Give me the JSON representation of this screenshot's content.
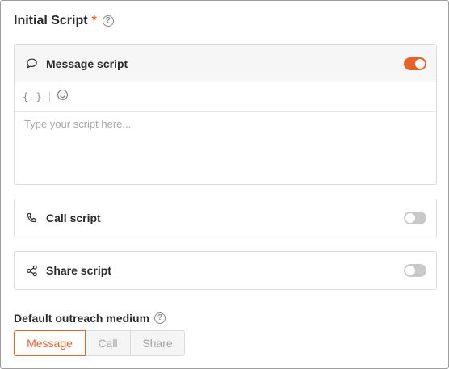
{
  "initial_script": {
    "title": "Initial Script",
    "required_mark": "*",
    "help": "?"
  },
  "message_script": {
    "label": "Message script",
    "enabled": true,
    "toolbar": {
      "variables": "{ }"
    },
    "placeholder": "Type your script here...",
    "value": ""
  },
  "call_script": {
    "label": "Call script",
    "enabled": false
  },
  "share_script": {
    "label": "Share script",
    "enabled": false
  },
  "default_medium": {
    "title": "Default outreach medium",
    "help": "?",
    "options": [
      "Message",
      "Call",
      "Share"
    ],
    "selected": "Message"
  },
  "colors": {
    "accent": "#e8622a",
    "toggle_off": "#c9c9c9"
  }
}
